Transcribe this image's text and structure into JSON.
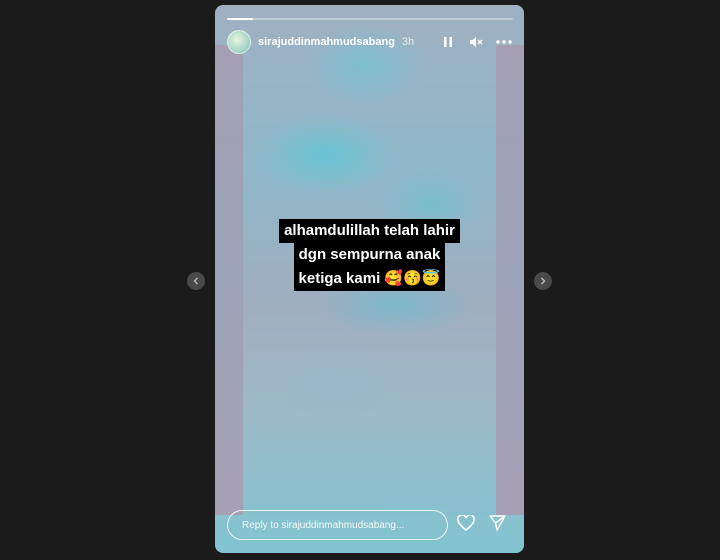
{
  "story": {
    "progress": 0.09,
    "username": "sirajuddinmahmudsabang",
    "time": "3h",
    "caption_lines": [
      "alhamdulillah telah lahir",
      "dgn sempurna anak",
      "ketiga kami 🥰😚😇"
    ]
  },
  "reply": {
    "placeholder": "Reply to sirajuddinmahmudsabang..."
  },
  "icons": {
    "pause": "pause-icon",
    "mute": "mute-icon",
    "more": "more-icon",
    "like": "heart-icon",
    "share": "send-icon",
    "prev": "chevron-left-icon",
    "next": "chevron-right-icon"
  }
}
